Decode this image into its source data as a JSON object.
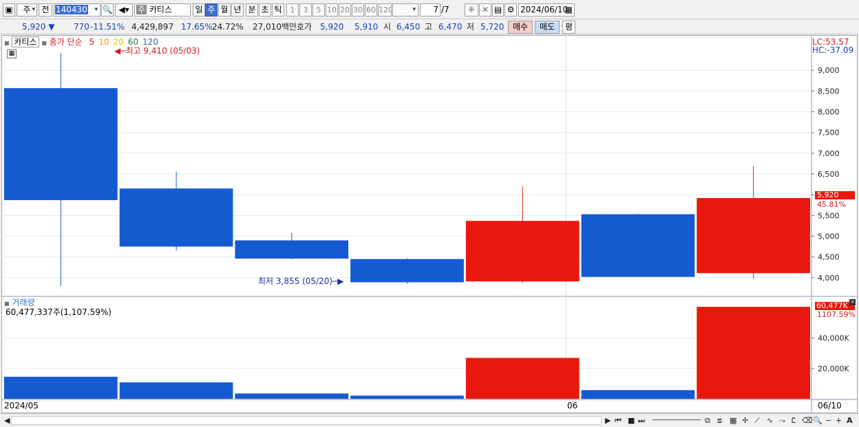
{
  "toolbar": {
    "type_select": "주",
    "prev_btn": "전",
    "code_value": "140430",
    "stock_name": "카티스",
    "stock_type_badge": "주",
    "periods": [
      "일",
      "주",
      "월",
      "년",
      "분",
      "초",
      "틱"
    ],
    "active_period": "주",
    "intervals": [
      "1",
      "3",
      "5",
      "10",
      "20",
      "30",
      "60",
      "120"
    ],
    "page_count": "7",
    "page_total": "/7",
    "date": "2024/06/10"
  },
  "info": {
    "price": "5,920",
    "change": "770",
    "change_pct": "-11.51%",
    "volume": "4,429,897",
    "turnover_pct": "17.65%",
    "ratio_pct": "24.72%",
    "trade_value": "27,010백만",
    "quote_label": "호가",
    "quote_ask": "5,920",
    "quote_bid": "5,910",
    "open_label": "시",
    "open": "6,450",
    "high_label": "고",
    "high": "6,470",
    "low_label": "저",
    "low": "5,720",
    "buy_btn": "매수",
    "sell_btn": "매도",
    "eval_btn": "평"
  },
  "price_panel": {
    "name": "카티스",
    "legend_prefix": "종가 단순",
    "ma_labels": [
      "5",
      "10",
      "20",
      "60",
      "120"
    ],
    "ma_colors": [
      "#d41a1a",
      "#e8a000",
      "#e8c000",
      "#208020",
      "#2060c0"
    ],
    "high_note": "최고 9,410 (05/03)",
    "low_note": "최저 3,855 (05/20)",
    "lc": "LC:53.57",
    "hc": "HC:-37.09",
    "current_tag": "5,920",
    "current_pct": "45.81%"
  },
  "volume_panel": {
    "title": "거래량",
    "value_text": "60,477,337주(1,107.59%)",
    "current_tag": "60,477K",
    "current_pct": "1107.59%"
  },
  "x_labels": {
    "left": "2024/05",
    "mid": "06",
    "right": "06/10"
  },
  "colors": {
    "up": "#e8190c",
    "down": "#155ad0",
    "accent": "#3e6ecb"
  },
  "chart_data": {
    "type": "candlestick",
    "period": "weekly",
    "price_axis": {
      "ticks": [
        4000,
        4500,
        5000,
        5500,
        6000,
        6500,
        7000,
        7500,
        8000,
        8500,
        9000
      ],
      "labels": [
        "4,000",
        "4,500",
        "5,000",
        "5,500",
        "6,000",
        "6,500",
        "7,000",
        "7,500",
        "8,000",
        "8,500",
        "9,000"
      ],
      "range": [
        3600,
        9700
      ]
    },
    "candles": [
      {
        "open": 8570,
        "high": 9410,
        "low": 3800,
        "close": 5870,
        "up": false
      },
      {
        "open": 6150,
        "high": 6560,
        "low": 4650,
        "close": 4750,
        "up": false
      },
      {
        "open": 4900,
        "high": 5080,
        "low": 4440,
        "close": 4460,
        "up": false
      },
      {
        "open": 4450,
        "high": 4470,
        "low": 3855,
        "close": 3890,
        "up": false
      },
      {
        "open": 3910,
        "high": 6200,
        "low": 3870,
        "close": 5370,
        "up": true
      },
      {
        "open": 5530,
        "high": 5540,
        "low": 4030,
        "close": 4020,
        "up": false
      },
      {
        "open": 4110,
        "high": 6690,
        "low": 3970,
        "close": 5920,
        "up": true
      }
    ],
    "volume_axis": {
      "ticks": [
        20000,
        40000
      ],
      "labels": [
        "20,000K",
        "40,000K"
      ],
      "range": [
        0,
        66000
      ]
    },
    "volumes": [
      14500,
      10800,
      3500,
      2100,
      26900,
      5700,
      60477
    ]
  }
}
